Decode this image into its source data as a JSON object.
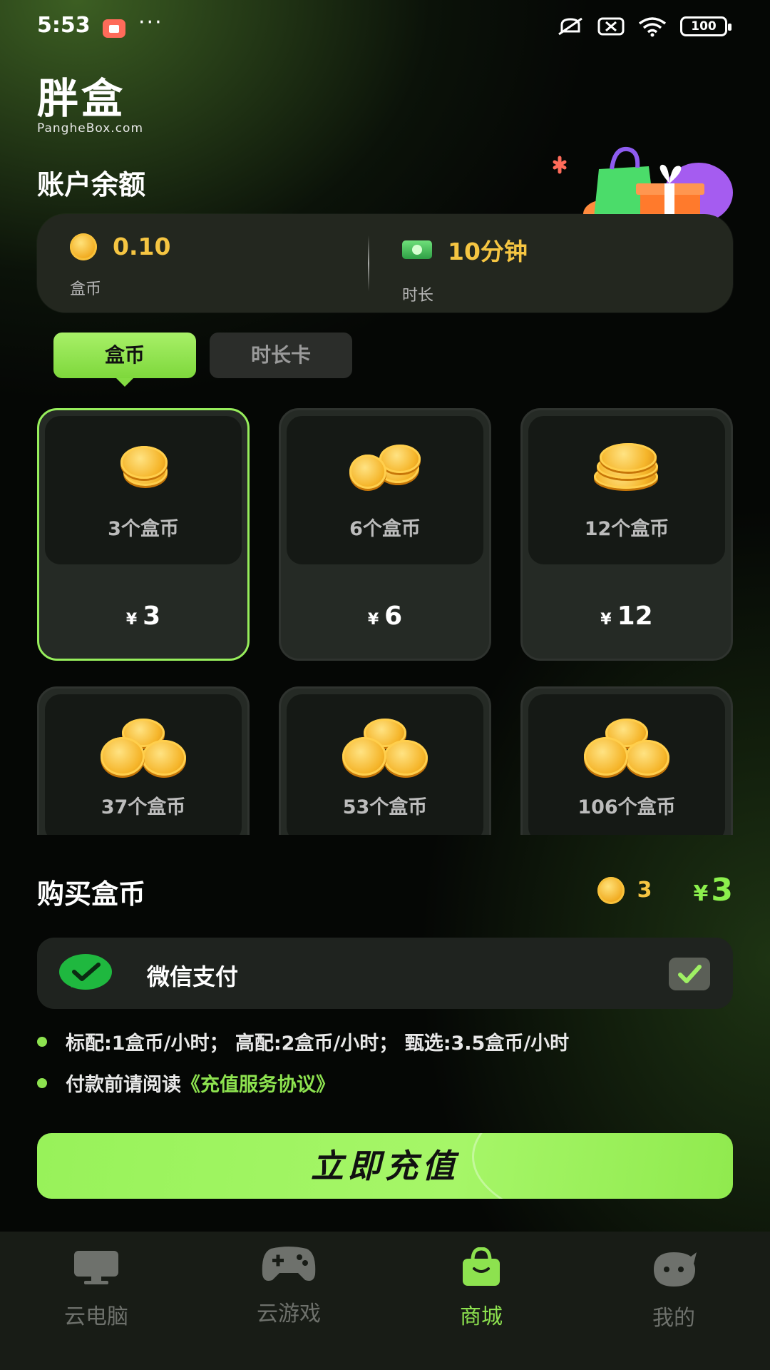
{
  "status_bar": {
    "time": "5:53",
    "more": "···",
    "battery": "100"
  },
  "logo": {
    "mark": "胖盒",
    "sub": "PangheBox.com"
  },
  "account": {
    "title": "账户余额",
    "coins": {
      "value": "0.10",
      "label": "盒币"
    },
    "time": {
      "value": "10分钟",
      "label": "时长"
    }
  },
  "tabs": [
    {
      "label": "盒币",
      "active": true
    },
    {
      "label": "时长卡",
      "active": false
    }
  ],
  "products": [
    {
      "amount": "3个盒币",
      "currency": "¥",
      "price": "3",
      "selected": true
    },
    {
      "amount": "6个盒币",
      "currency": "¥",
      "price": "6",
      "selected": false
    },
    {
      "amount": "12个盒币",
      "currency": "¥",
      "price": "12",
      "selected": false
    },
    {
      "amount": "37个盒币",
      "currency": "",
      "price": "",
      "selected": false
    },
    {
      "amount": "53个盒币",
      "currency": "",
      "price": "",
      "selected": false
    },
    {
      "amount": "106个盒币",
      "currency": "",
      "price": "",
      "selected": false
    }
  ],
  "buy": {
    "title": "购买盒币",
    "coin_count": "3",
    "currency": "¥",
    "price": "3"
  },
  "payment": {
    "label": "微信支付",
    "checked": true
  },
  "notes": {
    "pricing": "标配:1盒币/小时； 高配:2盒币/小时； 甄选:3.5盒币/小时",
    "agreement_prefix": "付款前请阅读",
    "agreement_link": "《充值服务协议》"
  },
  "recharge_button": "立即充值",
  "nav": [
    {
      "label": "云电脑",
      "icon": "monitor-icon",
      "active": false
    },
    {
      "label": "云游戏",
      "icon": "gamepad-icon",
      "active": false
    },
    {
      "label": "商城",
      "icon": "shopping-bag-icon",
      "active": true
    },
    {
      "label": "我的",
      "icon": "profile-face-icon",
      "active": false
    }
  ],
  "colors": {
    "accent": "#8de24f",
    "gold": "#f5c542",
    "card": "#252a25"
  }
}
